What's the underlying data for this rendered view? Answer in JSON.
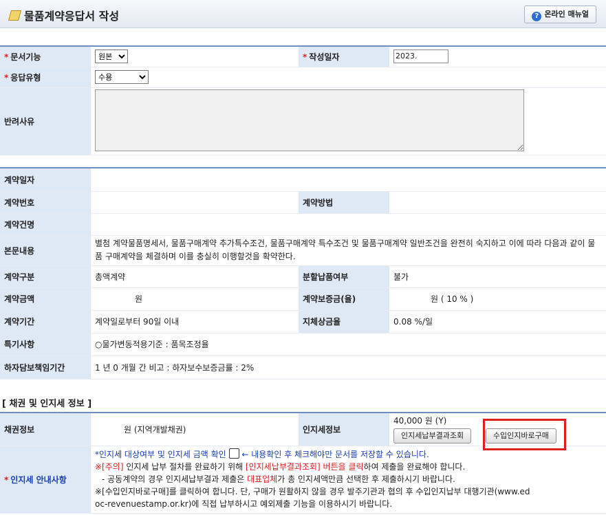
{
  "header": {
    "title": "물품계약응답서 작성",
    "manual_button": "온라인 매뉴얼"
  },
  "form": {
    "doc_function_label": "문서기능",
    "doc_function_value": "원본",
    "created_date_label": "작성일자",
    "created_date_value": "2023.",
    "response_type_label": "응답유형",
    "response_type_value": "수용",
    "reject_reason_label": "반려사유",
    "reject_reason_value": ""
  },
  "contract": {
    "date_label": "계약일자",
    "number_label": "계약번호",
    "method_label": "계약방법",
    "name_label": "계약건명",
    "body_label": "본문내용",
    "body_text": "별첨 계약물품명세서, 물품구매계약 추가특수조건, 물품구매계약 특수조건 및 물품구매계약 일반조건을 완전히 숙지하고 이에 따라 다음과 같이 물품 구매계약을 체결하며 이를 충실히 이행할것을 확약한다.",
    "type_label": "계약구분",
    "type_value": "총액계약",
    "split_label": "분할납품여부",
    "split_value": "불가",
    "amount_label": "계약금액",
    "amount_unit": "원",
    "deposit_label": "계약보증금(율)",
    "deposit_unit": "원 ( 10 % )",
    "period_label": "계약기간",
    "period_value": "계약일로부터 90일 이내",
    "delay_label": "지체상금율",
    "delay_value": "0.08 %/일",
    "special_label": "특기사항",
    "special_value": "○물가변동적용기준 : 품목조정율",
    "warranty_label": "하자담보책임기간",
    "warranty_value": "1 년 0 개월 간 비고 : 하자보수보증금률 : 2%"
  },
  "bond_section": {
    "title": "[ 채권 및 인지세 정보 ]",
    "bond_label": "채권정보",
    "bond_value": "원 (지역개발채권)",
    "stamp_label": "인지세정보",
    "stamp_amount": "40,000 원 (Y)",
    "btn_payment_result": "인지세납부결과조회",
    "btn_buy_stamp": "수입인지바로구매",
    "guide_label": "인지세 안내사항",
    "guide_line1_a": "*인지세 대상여부 및 인지세 금액 확인",
    "guide_line1_b": "← 내용확인 후 체크해야만 문서를 저장할 수 있습니다.",
    "guide_line2_a": "※[주의]",
    "guide_line2_b": "인지세 납부 절차를 완료하기 위해",
    "guide_line2_c": "[인지세납부결과조회] 버튼을 클릭",
    "guide_line2_d": "하여 제출을 완료해야 합니다.",
    "guide_line3_a": "- 공동계약의 경우 인지세납부결과 제출은",
    "guide_line3_b": "대표업체",
    "guide_line3_c": "가 총 인지세액만큼 선택한 후 제출하시기 바랍니다.",
    "guide_line4": "※[수입인지바로구매]를 클릭하여 합니다. 단, 구매가 원활하지 않을 경우 발주기관과 협의 후 수입인지납부 대행기관(www.ed",
    "guide_line5": "oc-revenuestamp.or.kr)에 직접 납부하시고 예외제출 기능을 이용하시기 바랍니다."
  }
}
